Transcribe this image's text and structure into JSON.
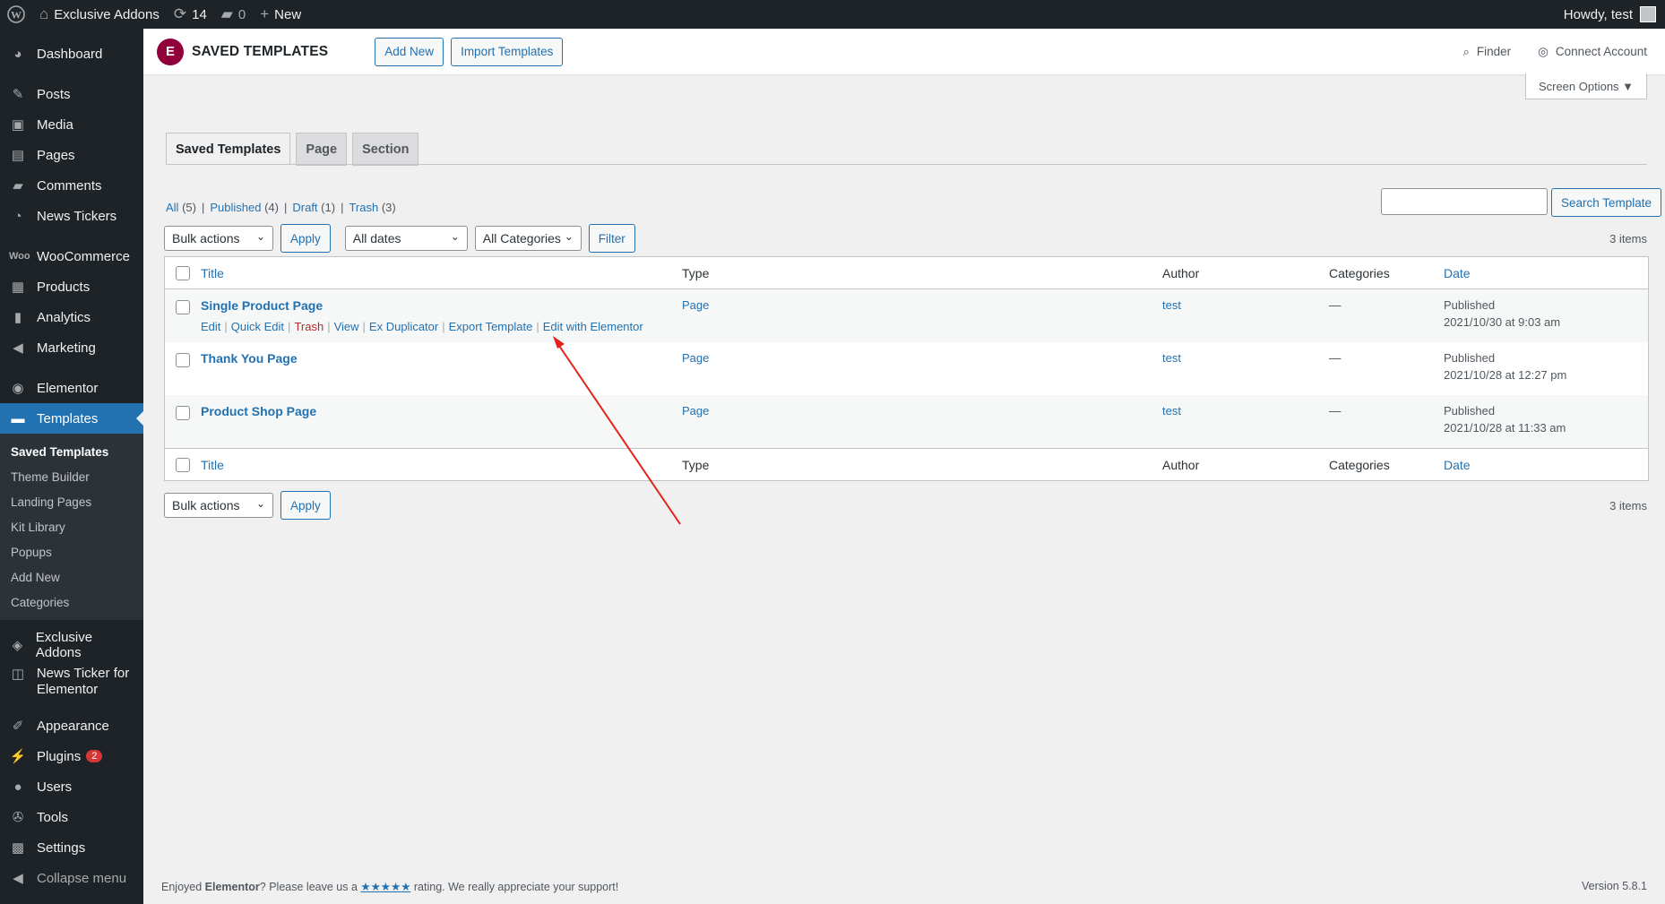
{
  "adminbar": {
    "site_name": "Exclusive Addons",
    "updates_count": "14",
    "comments_count": "0",
    "new_label": "New",
    "howdy": "Howdy, test"
  },
  "sidebar": {
    "items": [
      {
        "label": "Dashboard",
        "icon": "dashboard-icon"
      },
      {
        "label": "Posts",
        "icon": "pin-icon"
      },
      {
        "label": "Media",
        "icon": "media-icon"
      },
      {
        "label": "Pages",
        "icon": "pages-icon"
      },
      {
        "label": "Comments",
        "icon": "comment-icon"
      },
      {
        "label": "News Tickers",
        "icon": "news-icon"
      },
      {
        "label": "WooCommerce",
        "icon": "woo-icon"
      },
      {
        "label": "Products",
        "icon": "products-icon"
      },
      {
        "label": "Analytics",
        "icon": "bar-chart-icon"
      },
      {
        "label": "Marketing",
        "icon": "megaphone-icon"
      },
      {
        "label": "Elementor",
        "icon": "elementor-icon"
      },
      {
        "label": "Templates",
        "icon": "folder-icon"
      },
      {
        "label": "Exclusive Addons",
        "icon": "exad-icon"
      },
      {
        "label": "News Ticker for Elementor",
        "icon": "ticker-icon"
      },
      {
        "label": "Appearance",
        "icon": "brush-icon"
      },
      {
        "label": "Plugins",
        "icon": "plugin-icon",
        "badge": "2"
      },
      {
        "label": "Users",
        "icon": "users-icon"
      },
      {
        "label": "Tools",
        "icon": "wrench-icon"
      },
      {
        "label": "Settings",
        "icon": "settings-icon"
      },
      {
        "label": "Collapse menu",
        "icon": "collapse-icon"
      }
    ],
    "submenu": [
      "Saved Templates",
      "Theme Builder",
      "Landing Pages",
      "Kit Library",
      "Popups",
      "Add New",
      "Categories"
    ]
  },
  "header": {
    "title": "SAVED TEMPLATES",
    "add_new": "Add New",
    "import": "Import Templates",
    "finder": "Finder",
    "connect": "Connect Account",
    "logo_letter": "E"
  },
  "screen_options": "Screen Options ▼",
  "tabs": [
    "Saved Templates",
    "Page",
    "Section"
  ],
  "filters": {
    "all": "All",
    "all_count": "(5)",
    "published": "Published",
    "published_count": "(4)",
    "draft": "Draft",
    "draft_count": "(1)",
    "trash": "Trash",
    "trash_count": "(3)"
  },
  "search": {
    "button": "Search Template",
    "value": ""
  },
  "tablenav": {
    "bulk": "Bulk actions",
    "apply": "Apply",
    "dates": "All dates",
    "categories": "All Categories",
    "filter": "Filter",
    "items": "3 items"
  },
  "table": {
    "columns": {
      "title": "Title",
      "type": "Type",
      "author": "Author",
      "categories": "Categories",
      "date": "Date"
    },
    "rows": [
      {
        "title": "Single Product Page",
        "type": "Page",
        "author": "test",
        "categories": "—",
        "status": "Published",
        "datetime": "2021/10/30 at 9:03 am"
      },
      {
        "title": "Thank You Page",
        "type": "Page",
        "author": "test",
        "categories": "—",
        "status": "Published",
        "datetime": "2021/10/28 at 12:27 pm"
      },
      {
        "title": "Product Shop Page",
        "type": "Page",
        "author": "test",
        "categories": "—",
        "status": "Published",
        "datetime": "2021/10/28 at 11:33 am"
      }
    ],
    "row_actions": [
      "Edit",
      "Quick Edit",
      "Trash",
      "View",
      "Ex Duplicator",
      "Export Template",
      "Edit with Elementor"
    ]
  },
  "footer": {
    "before": "Enjoyed ",
    "brand": "Elementor",
    "middle": "? Please leave us a ",
    "stars": "★★★★★",
    "after": " rating. We really appreciate your support!",
    "version": "Version 5.8.1"
  },
  "colors": {
    "accent": "#2271b1",
    "admin_dark": "#1d2327",
    "elementor": "#92003b",
    "annotation": "#e0241b"
  }
}
